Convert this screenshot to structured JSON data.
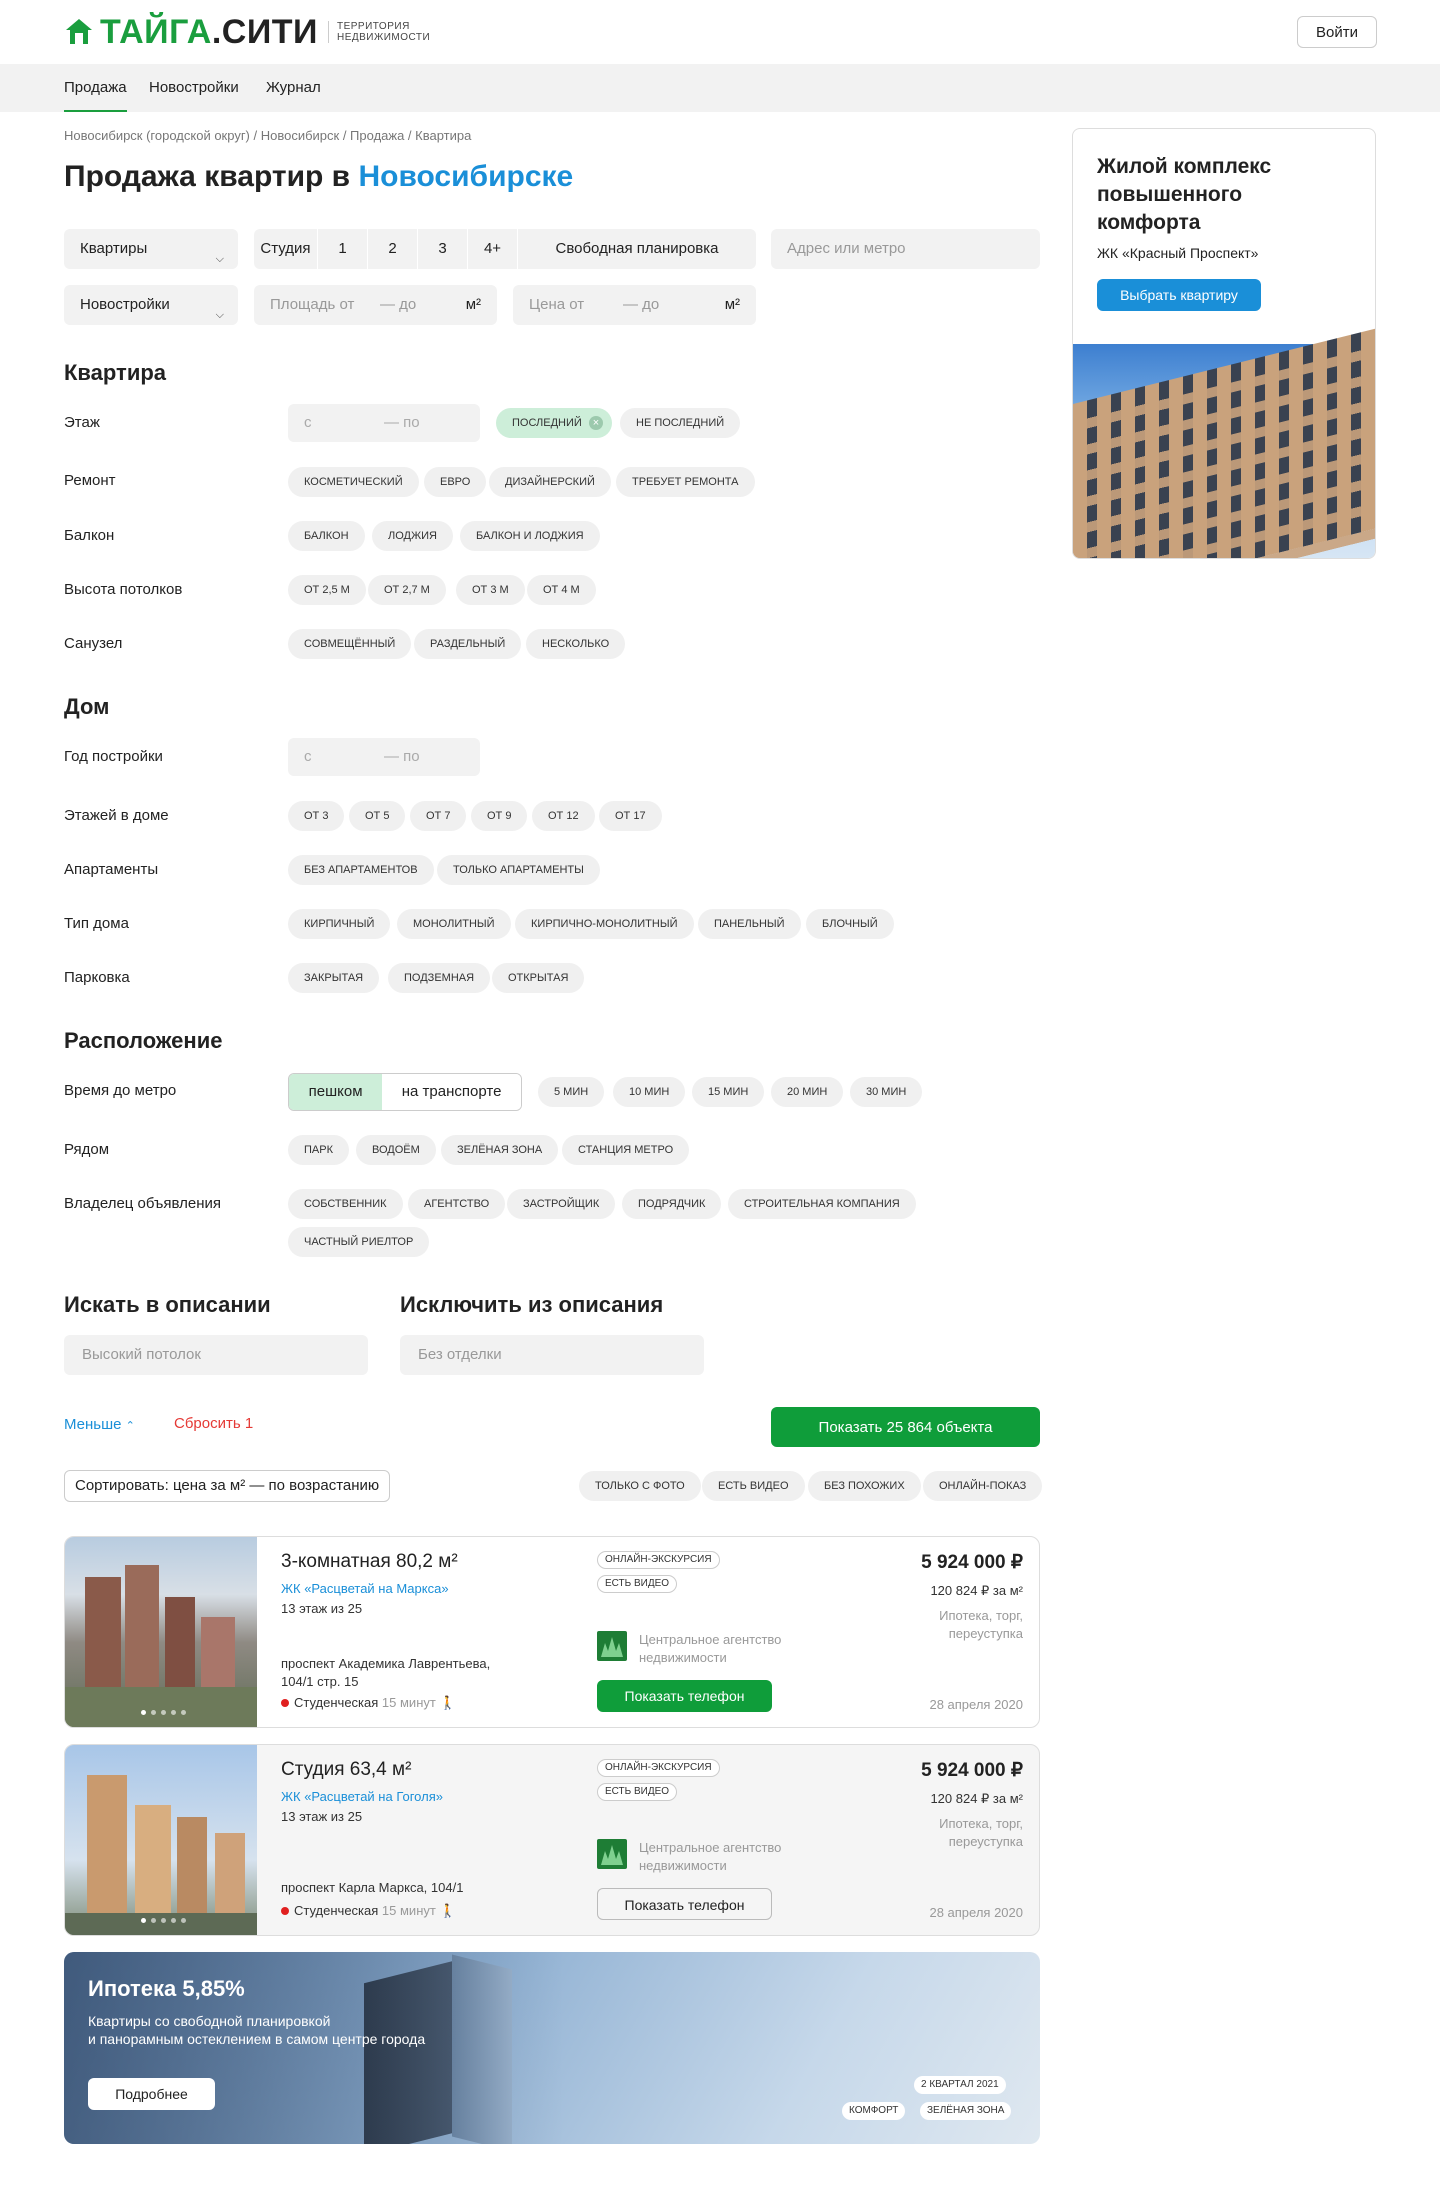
{
  "header": {
    "brand_main": "ТАЙГА",
    "brand_suffix": ".СИТИ",
    "tagline_1": "ТЕРРИТОРИЯ",
    "tagline_2": "НЕДВИЖИМОСТИ",
    "login_label": "Войти"
  },
  "nav": {
    "items": [
      "Продажа",
      "Новостройки",
      "Журнал"
    ]
  },
  "breadcrumbs": "Новосибирск (городской округ) / Новосибирск / Продажа / Квартира",
  "page_title": {
    "prefix": "Продажа квартир в ",
    "city": "Новосибирске"
  },
  "filters": {
    "type_select": "Квартиры",
    "rooms": [
      "Студия",
      "1",
      "2",
      "3",
      "4+",
      "Свободная планировка"
    ],
    "address_placeholder": "Адрес или метро",
    "market_select": "Новостройки",
    "area_from": "Площадь от",
    "area_to": "— до",
    "area_unit": "м²",
    "price_from": "Цена от",
    "price_to": "— до",
    "price_unit": "м²"
  },
  "section_apartment": {
    "title": "Квартира",
    "floor_label": "Этаж",
    "floor_from": "с",
    "floor_to": "— по",
    "floor_chips": [
      "последний",
      "не последний"
    ],
    "repair_label": "Ремонт",
    "repair_chips": [
      "косметический",
      "евро",
      "дизайнерский",
      "требует ремонта"
    ],
    "balcony_label": "Балкон",
    "balcony_chips": [
      "балкон",
      "лоджия",
      "балкон и лоджия"
    ],
    "ceiling_label": "Высота потолков",
    "ceiling_chips": [
      "от 2,5 м",
      "от 2,7 м",
      "от 3 м",
      "от 4 м"
    ],
    "bath_label": "Санузел",
    "bath_chips": [
      "совмещённый",
      "раздельный",
      "несколько"
    ]
  },
  "section_house": {
    "title": "Дом",
    "year_label": "Год постройки",
    "year_from": "с",
    "year_to": "— по",
    "floors_label": "Этажей в доме",
    "floors_chips": [
      "от 3",
      "от 5",
      "от 7",
      "от 9",
      "от 12",
      "от 17"
    ],
    "apart_label": "Апартаменты",
    "apart_chips": [
      "без апартаментов",
      "только апартаменты"
    ],
    "type_label": "Тип дома",
    "type_chips": [
      "кирпичный",
      "монолитный",
      "кирпично-монолитный",
      "панельный",
      "блочный"
    ],
    "parking_label": "Парковка",
    "parking_chips": [
      "закрытая",
      "подземная",
      "открытая"
    ]
  },
  "section_location": {
    "title": "Расположение",
    "metro_label": "Время до метро",
    "toggle": [
      "пешком",
      "на транспорте"
    ],
    "metro_chips": [
      "5 мин",
      "10 мин",
      "15 мин",
      "20 мин",
      "30 мин"
    ],
    "near_label": "Рядом",
    "near_chips": [
      "парк",
      "водоём",
      "зелёная зона",
      "станция метро"
    ],
    "owner_label": "Владелец объявления",
    "owner_chips": [
      "собственник",
      "агентство",
      "застройщик",
      "подрядчик",
      "строительная компания",
      "частный риелтор"
    ]
  },
  "description": {
    "include_title": "Искать в описании",
    "include_placeholder": "Высокий потолок",
    "exclude_title": "Исключить из описания",
    "exclude_placeholder": "Без отделки"
  },
  "actions": {
    "less_label": "Меньше",
    "reset_label": "Сбросить 1",
    "show_label": "Показать 25 864 объекта"
  },
  "sort": {
    "label": "Сортировать: цена за м² — по возрастанию",
    "chips": [
      "только с фото",
      "есть видео",
      "без похожих",
      "онлайн-показ"
    ]
  },
  "listings": [
    {
      "title": "3-комнатная 80,2 м²",
      "complex": "ЖК «Расцветай на Маркса»",
      "floor": "13 этаж из 25",
      "address": "проспект Академика Лаврентьева, 104/1 стр. 15",
      "metro": "Студенческая",
      "metro_time": "15 минут",
      "badges": [
        "онлайн-экскурсия",
        "есть видео"
      ],
      "agency": "Центральное агентство недвижимости",
      "phone_label": "Показать телефон",
      "price": "5 924 000 ₽",
      "price_m2": "120 824 ₽ за м²",
      "conditions": "Ипотека, торг, переуступка",
      "date": "28 апреля 2020"
    },
    {
      "title": "Студия 63,4 м²",
      "complex": "ЖК «Расцветай на Гоголя»",
      "floor": "13 этаж из 25",
      "address": "проспект Карла Маркса, 104/1",
      "metro": "Студенческая",
      "metro_time": "15 минут",
      "badges": [
        "онлайн-экскурсия",
        "есть видео"
      ],
      "agency": "Центральное агентство недвижимости",
      "phone_label": "Показать телефон",
      "price": "5 924 000 ₽",
      "price_m2": "120 824 ₽ за м²",
      "conditions": "Ипотека, торг, переуступка",
      "date": "28 апреля 2020"
    }
  ],
  "promo_banner": {
    "title": "Ипотека 5,85%",
    "line1": "Квартиры со свободной планировкой",
    "line2": "и панорамным остеклением в самом центре города",
    "button": "Подробнее",
    "tags": [
      "2 квартал 2021",
      "комфорт",
      "зелёная зона"
    ]
  },
  "sidebar_ad": {
    "title": "Жилой комплекс повышенного комфорта",
    "subtitle": "ЖК «Красный Проспект»",
    "button": "Выбрать квартиру"
  },
  "colors": {
    "brand_green": "#1a9e3e",
    "link_blue": "#1a8fd8",
    "cta_green": "#0f9d3a",
    "reset_red": "#e53935"
  },
  "icons": [
    "house-logo-icon",
    "chevron-down-icon",
    "close-icon",
    "chevron-up-icon",
    "walk-icon",
    "agency-logo-icon"
  ]
}
